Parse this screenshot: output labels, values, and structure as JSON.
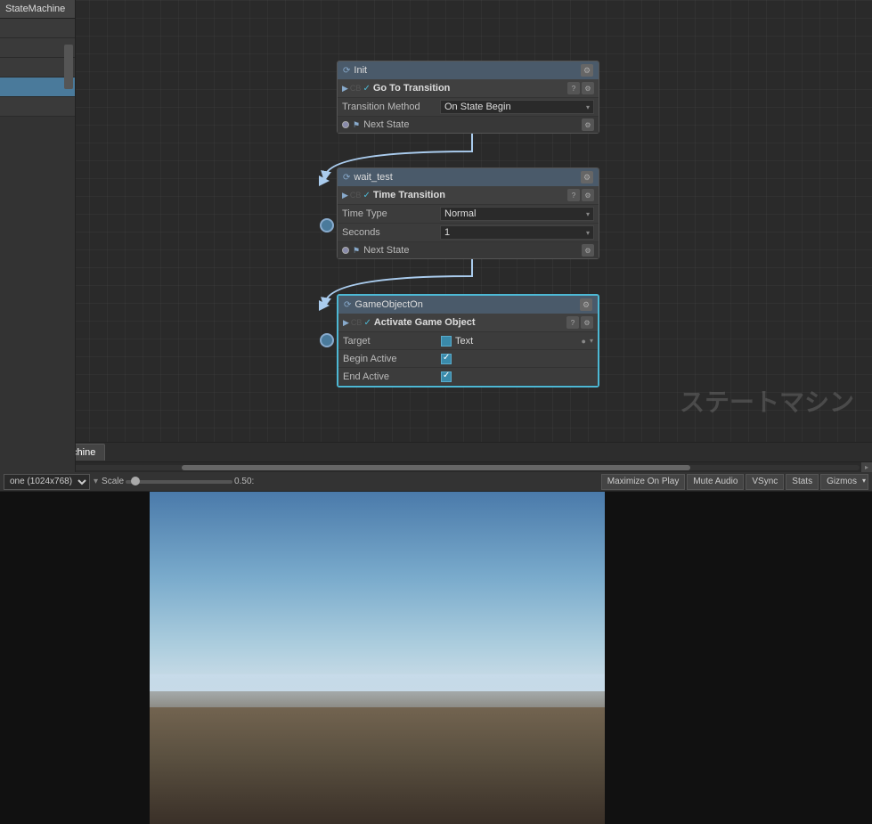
{
  "sidebar": {
    "title": "StateMachine",
    "items": [
      {
        "label": "",
        "type": "blank"
      },
      {
        "label": "",
        "type": "blank"
      },
      {
        "label": "",
        "type": "blank"
      }
    ]
  },
  "nodes": {
    "init": {
      "title": "Init",
      "action": {
        "label": "Go To Transition",
        "field_label": "Transition Method",
        "field_value": "On State Begin"
      },
      "next_state": "Next State"
    },
    "wait_test": {
      "title": "wait_test",
      "action": {
        "label": "Time Transition",
        "time_type_label": "Time Type",
        "time_type_value": "Normal",
        "seconds_label": "Seconds",
        "seconds_value": "1"
      },
      "next_state": "Next State"
    },
    "game_object_on": {
      "title": "GameObjectOn",
      "action": {
        "label": "Activate Game Object",
        "target_label": "Target",
        "target_value": "Text",
        "begin_active_label": "Begin Active",
        "end_active_label": "End Active"
      }
    }
  },
  "watermark": "ステートマシン",
  "tabs": [
    {
      "label": "New StateMachine",
      "active": true
    }
  ],
  "toolbar": {
    "resolution_label": "one (1024x768)",
    "scale_label": "Scale",
    "scale_value": "0.50:",
    "maximize_btn": "Maximize On Play",
    "mute_btn": "Mute Audio",
    "vsync_btn": "VSync",
    "stats_btn": "Stats",
    "gizmos_btn": "Gizmos"
  }
}
